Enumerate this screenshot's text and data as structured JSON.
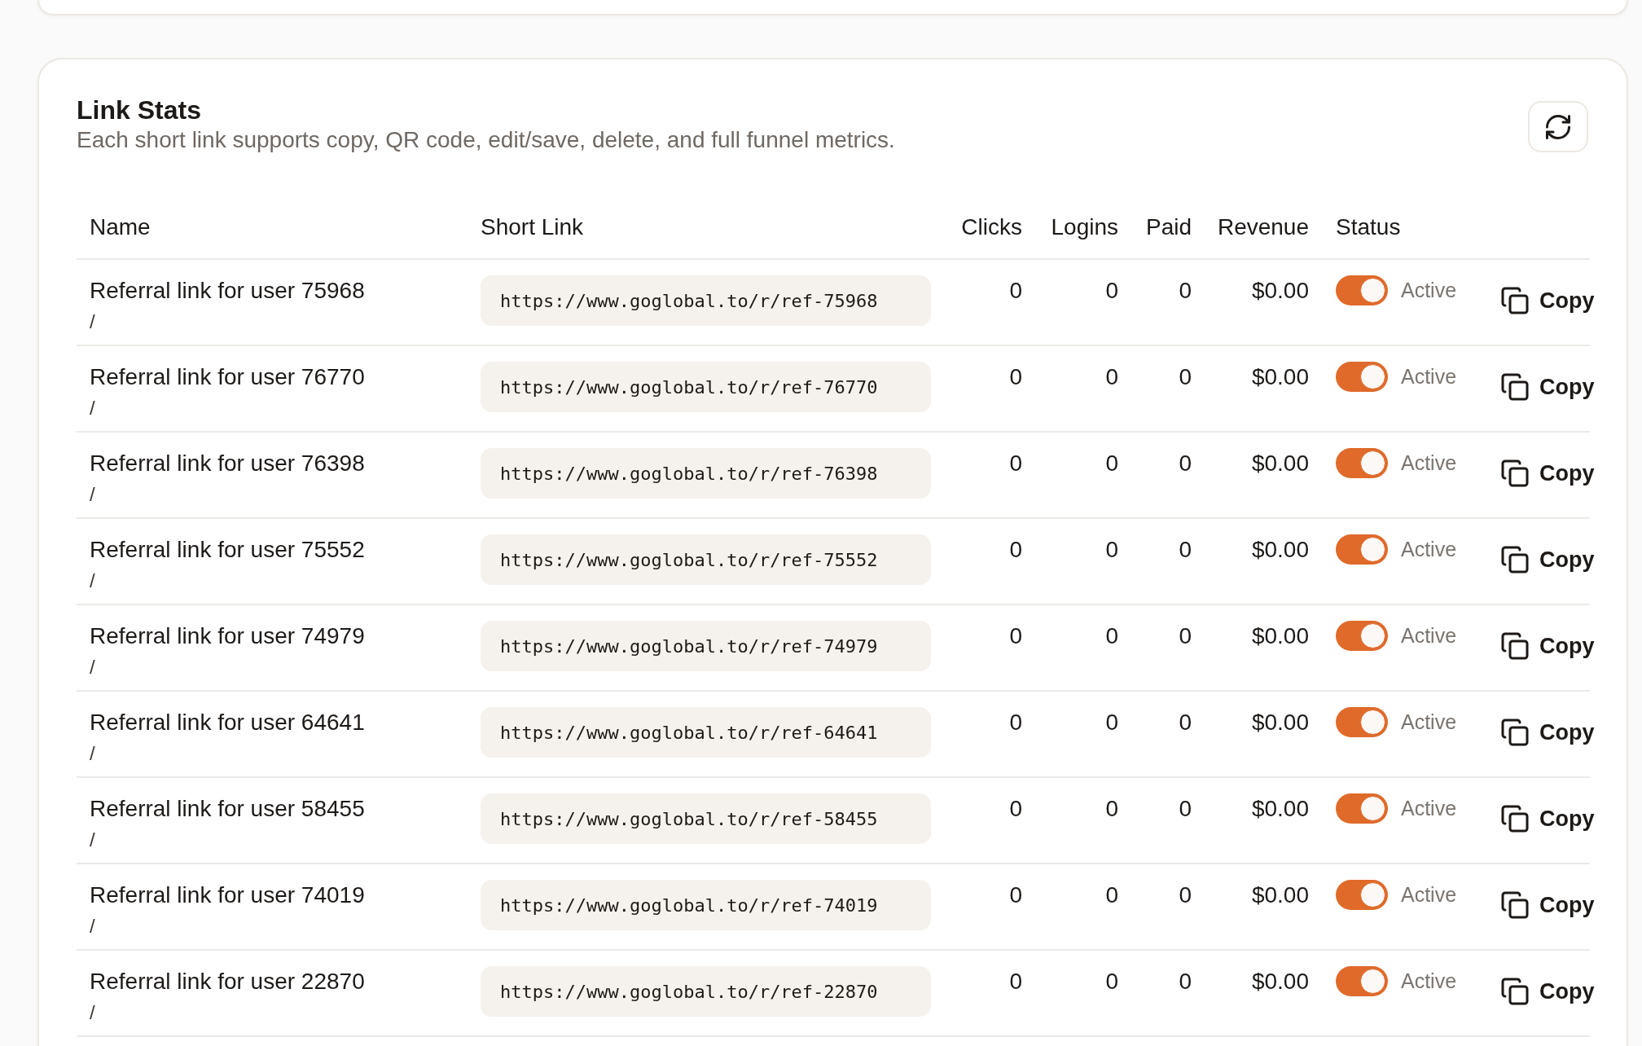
{
  "link_stats": {
    "title": "Link Stats",
    "subtitle": "Each short link supports copy, QR code, edit/save, delete, and full funnel metrics.",
    "table": {
      "columns": [
        "Name",
        "Short Link",
        "Clicks",
        "Logins",
        "Paid",
        "Revenue",
        "Status"
      ],
      "rows": [
        {
          "name": "Referral link for user 75968",
          "path": "/",
          "short_link": "https://www.goglobal.to/r/ref-75968",
          "clicks": "0",
          "logins": "0",
          "paid": "0",
          "revenue": "$0.00",
          "status": {
            "on": true,
            "label": "Active"
          },
          "action": "Copy"
        },
        {
          "name": "Referral link for user 76770",
          "path": "/",
          "short_link": "https://www.goglobal.to/r/ref-76770",
          "clicks": "0",
          "logins": "0",
          "paid": "0",
          "revenue": "$0.00",
          "status": {
            "on": true,
            "label": "Active"
          },
          "action": "Copy"
        },
        {
          "name": "Referral link for user 76398",
          "path": "/",
          "short_link": "https://www.goglobal.to/r/ref-76398",
          "clicks": "0",
          "logins": "0",
          "paid": "0",
          "revenue": "$0.00",
          "status": {
            "on": true,
            "label": "Active"
          },
          "action": "Copy"
        },
        {
          "name": "Referral link for user 75552",
          "path": "/",
          "short_link": "https://www.goglobal.to/r/ref-75552",
          "clicks": "0",
          "logins": "0",
          "paid": "0",
          "revenue": "$0.00",
          "status": {
            "on": true,
            "label": "Active"
          },
          "action": "Copy"
        },
        {
          "name": "Referral link for user 74979",
          "path": "/",
          "short_link": "https://www.goglobal.to/r/ref-74979",
          "clicks": "0",
          "logins": "0",
          "paid": "0",
          "revenue": "$0.00",
          "status": {
            "on": true,
            "label": "Active"
          },
          "action": "Copy"
        },
        {
          "name": "Referral link for user 64641",
          "path": "/",
          "short_link": "https://www.goglobal.to/r/ref-64641",
          "clicks": "0",
          "logins": "0",
          "paid": "0",
          "revenue": "$0.00",
          "status": {
            "on": true,
            "label": "Active"
          },
          "action": "Copy"
        },
        {
          "name": "Referral link for user 58455",
          "path": "/",
          "short_link": "https://www.goglobal.to/r/ref-58455",
          "clicks": "0",
          "logins": "0",
          "paid": "0",
          "revenue": "$0.00",
          "status": {
            "on": true,
            "label": "Active"
          },
          "action": "Copy"
        },
        {
          "name": "Referral link for user 74019",
          "path": "/",
          "short_link": "https://www.goglobal.to/r/ref-74019",
          "clicks": "0",
          "logins": "0",
          "paid": "0",
          "revenue": "$0.00",
          "status": {
            "on": true,
            "label": "Active"
          },
          "action": "Copy"
        },
        {
          "name": "Referral link for user 22870",
          "path": "/",
          "short_link": "https://www.goglobal.to/r/ref-22870",
          "clicks": "0",
          "logins": "0",
          "paid": "0",
          "revenue": "$0.00",
          "status": {
            "on": true,
            "label": "Active"
          },
          "action": "Copy"
        }
      ]
    }
  }
}
